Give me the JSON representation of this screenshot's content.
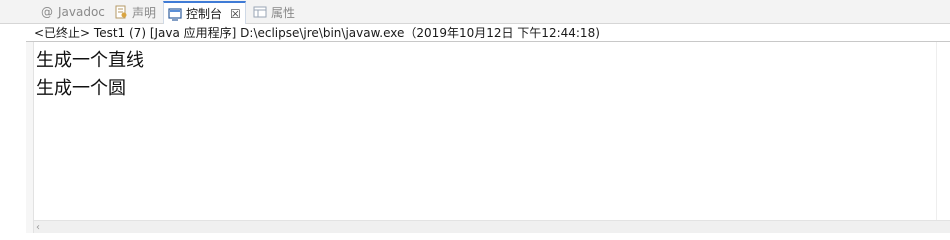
{
  "tabs": [
    {
      "label": "Javadoc",
      "icon": "at-sign-icon",
      "active": false
    },
    {
      "label": "声明",
      "icon": "declaration-icon",
      "active": false
    },
    {
      "label": "控制台",
      "icon": "console-icon",
      "active": true,
      "close": "☒"
    },
    {
      "label": "属性",
      "icon": "properties-icon",
      "active": false
    }
  ],
  "status": {
    "text": "<已终止> Test1 (7)  [Java 应用程序] D:\\eclipse\\jre\\bin\\javaw.exe（2019年10月12日 下午12:44:18)"
  },
  "console": {
    "lines": [
      "生成一个直线",
      "生成一个圆"
    ]
  },
  "hscroll": {
    "left_arrow": "‹"
  },
  "colors": {
    "active_tab_accent": "#3f7bd6",
    "tab_bar": "#f3f3f3"
  }
}
